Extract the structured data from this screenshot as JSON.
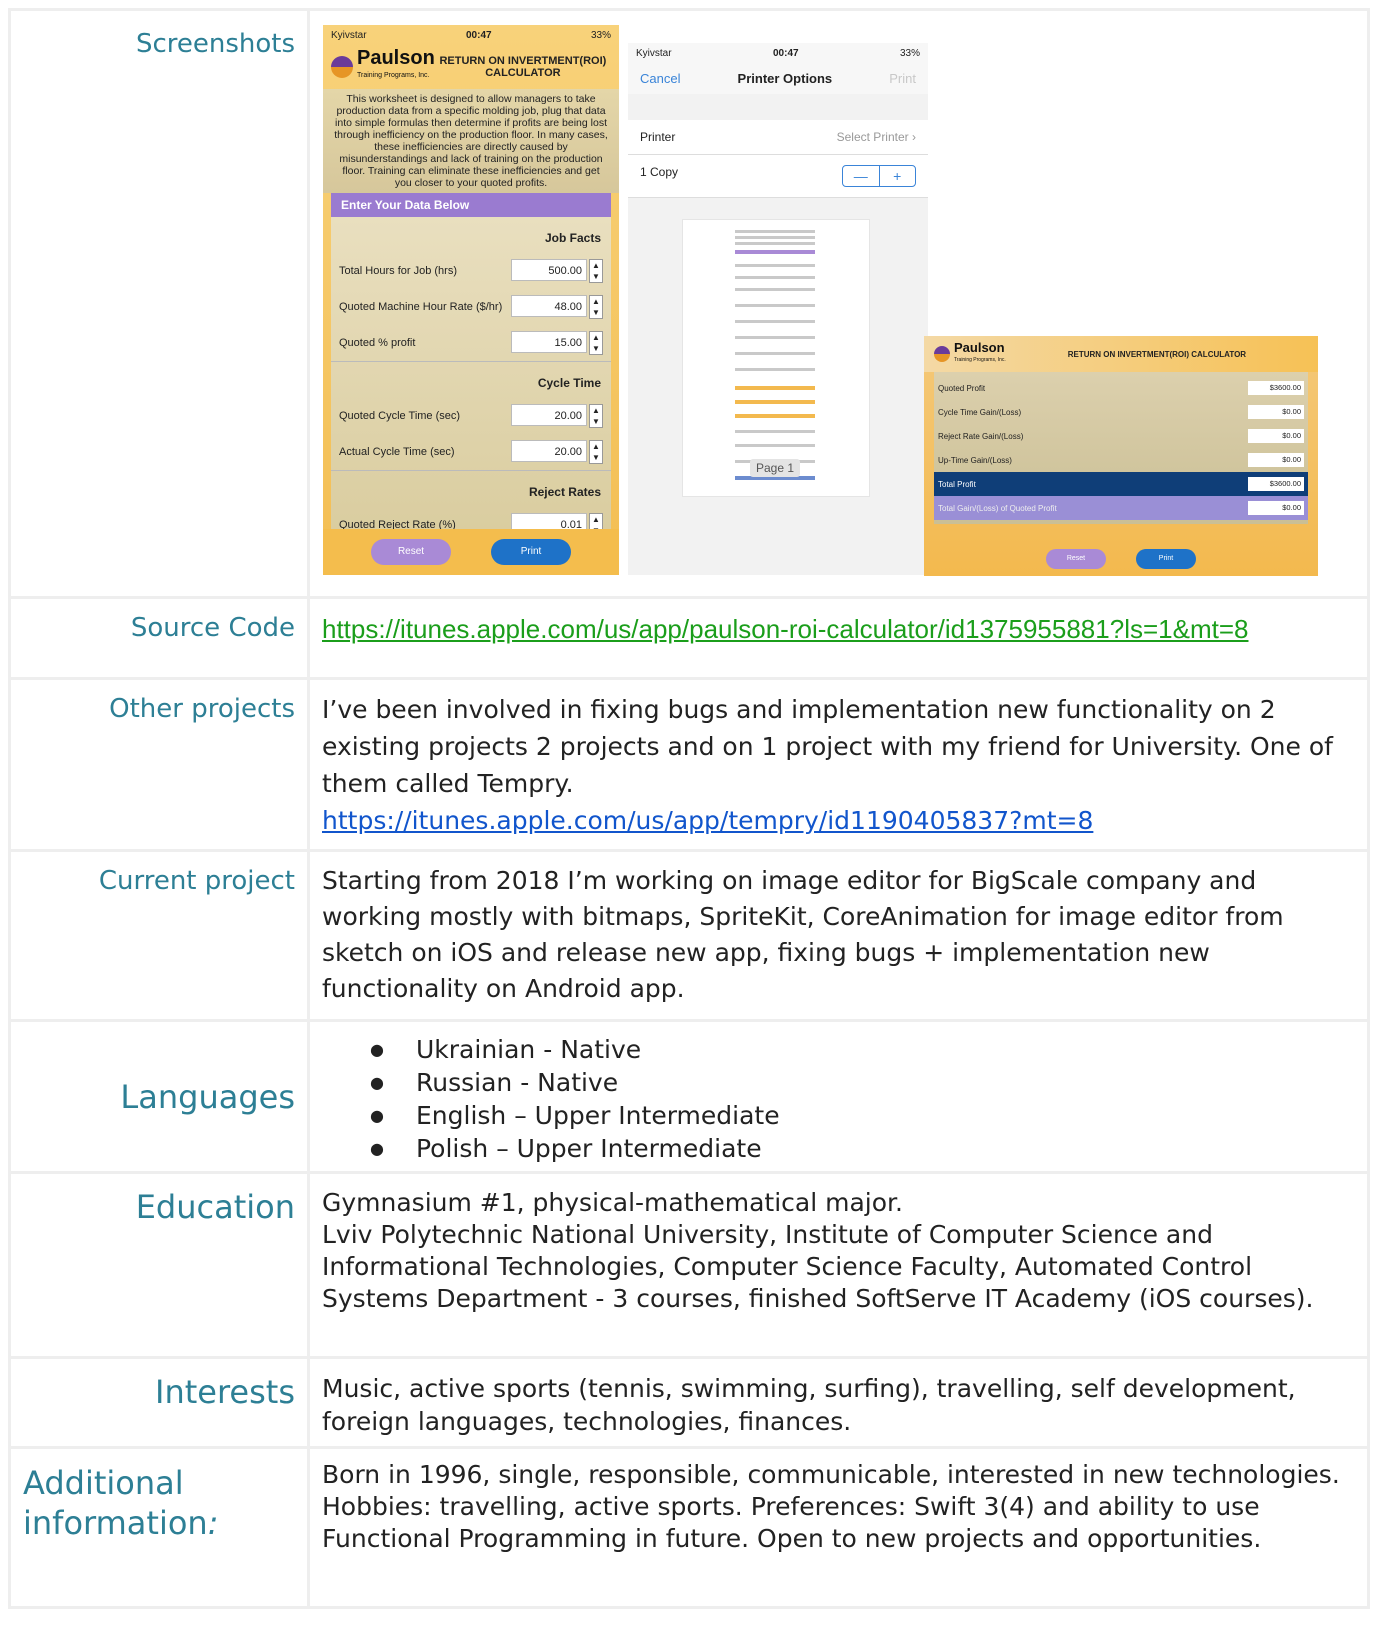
{
  "rows": {
    "screenshots": {
      "label": "Screenshots",
      "phone1": {
        "carrier": "Kyivstar",
        "time": "00:47",
        "battery": "33%",
        "brand": "Paulson",
        "brand_sub": "Training Programs, Inc.",
        "title": "RETURN ON INVERTMENT(ROI) CALCULATOR",
        "intro": "This worksheet is designed to allow managers to take production data from a specific molding job, plug that data into simple formulas then determine if profits are being lost through inefficiency on the production floor. In many cases, these inefficiencies are directly caused by misunderstandings and lack of training on the production floor. Training can eliminate these inefficiencies and get you closer to your quoted profits.",
        "enter": "Enter Your Data Below",
        "sec1": "Job Facts",
        "f1_label": "Total Hours for Job (hrs)",
        "f1_value": "500.00",
        "f2_label": "Quoted Machine Hour Rate ($/hr)",
        "f2_value": "48.00",
        "f3_label": "Quoted % profit",
        "f3_value": "15.00",
        "sec2": "Cycle Time",
        "f4_label": "Quoted Cycle Time (sec)",
        "f4_value": "20.00",
        "f5_label": "Actual Cycle Time (sec)",
        "f5_value": "20.00",
        "sec3": "Reject Rates",
        "f6_label": "Quoted Reject Rate (%)",
        "f6_value": "0.01",
        "reset": "Reset",
        "print": "Print"
      },
      "phone2": {
        "carrier": "Kyivstar",
        "time": "00:47",
        "battery": "33%",
        "cancel": "Cancel",
        "title": "Printer Options",
        "print": "Print",
        "printer_label": "Printer",
        "printer_value": "Select Printer",
        "copies": "1 Copy",
        "minus": "—",
        "plus": "+",
        "page_badge": "Page 1"
      },
      "tablet": {
        "brand": "Paulson",
        "brand_sub": "Training Programs, Inc.",
        "title": "RETURN ON INVERTMENT(ROI) CALCULATOR",
        "r1_label": "Quoted Profit",
        "r1_value": "$3600.00",
        "r2_label": "Cycle Time Gain/(Loss)",
        "r2_value": "$0.00",
        "r3_label": "Reject Rate Gain/(Loss)",
        "r3_value": "$0.00",
        "r4_label": "Up-Time Gain/(Loss)",
        "r4_value": "$0.00",
        "r5_label": "Total Profit",
        "r5_value": "$3600.00",
        "r6_label": "Total Gain/(Loss) of Quoted Profit",
        "r6_value": "$0.00",
        "reset": "Reset",
        "print": "Print"
      }
    },
    "source": {
      "label": "Source Code",
      "link": "https://itunes.apple.com/us/app/paulson-roi-calculator/id1375955881?ls=1&mt=8"
    },
    "other": {
      "label": "Other projects",
      "text": "I’ve been involved in fixing bugs and implementation new functionality on 2 existing projects 2 projects and on 1 project with my friend for University. One of them called Tempry.",
      "link": "https://itunes.apple.com/us/app/tempry/id1190405837?mt=8"
    },
    "current": {
      "label": "Current project",
      "text": "Starting from 2018 I’m working on image editor for BigScale company and working mostly with bitmaps, SpriteKit, CoreAnimation for image editor from sketch on iOS and release new app, fixing bugs + implementation new functionality on Android app."
    },
    "languages": {
      "label": "Languages",
      "items": [
        "Ukrainian - Native",
        "Russian - Native",
        "English – Upper Intermediate",
        "Polish – Upper Intermediate"
      ]
    },
    "education": {
      "label": "Education",
      "line1": "Gymnasium #1, physical-mathematical major.",
      "line2": "Lviv Polytechnic National University, Institute of Computer Science and Informational Technologies, Computer Science Faculty, Automated Control Systems Department - 3 courses, finished SoftServe IT Academy (iOS courses)."
    },
    "interests": {
      "label": "Interests",
      "text": "Music, active sports (tennis, swimming, surfing), travelling, self development, foreign languages, technologies, finances."
    },
    "additional": {
      "label": "Additional information",
      "label_colon": ":",
      "text": "Born in 1996, single, responsible, communicable, interested in new technologies. Hobbies: travelling, active sports. Preferences: Swift 3(4) and ability to use Functional Programming in future. Open to new projects and opportunities."
    }
  },
  "colors": {
    "label": "#2d7f95",
    "source_link": "#1b9e1b",
    "link": "#1155cc",
    "border": "#eeeeee"
  }
}
